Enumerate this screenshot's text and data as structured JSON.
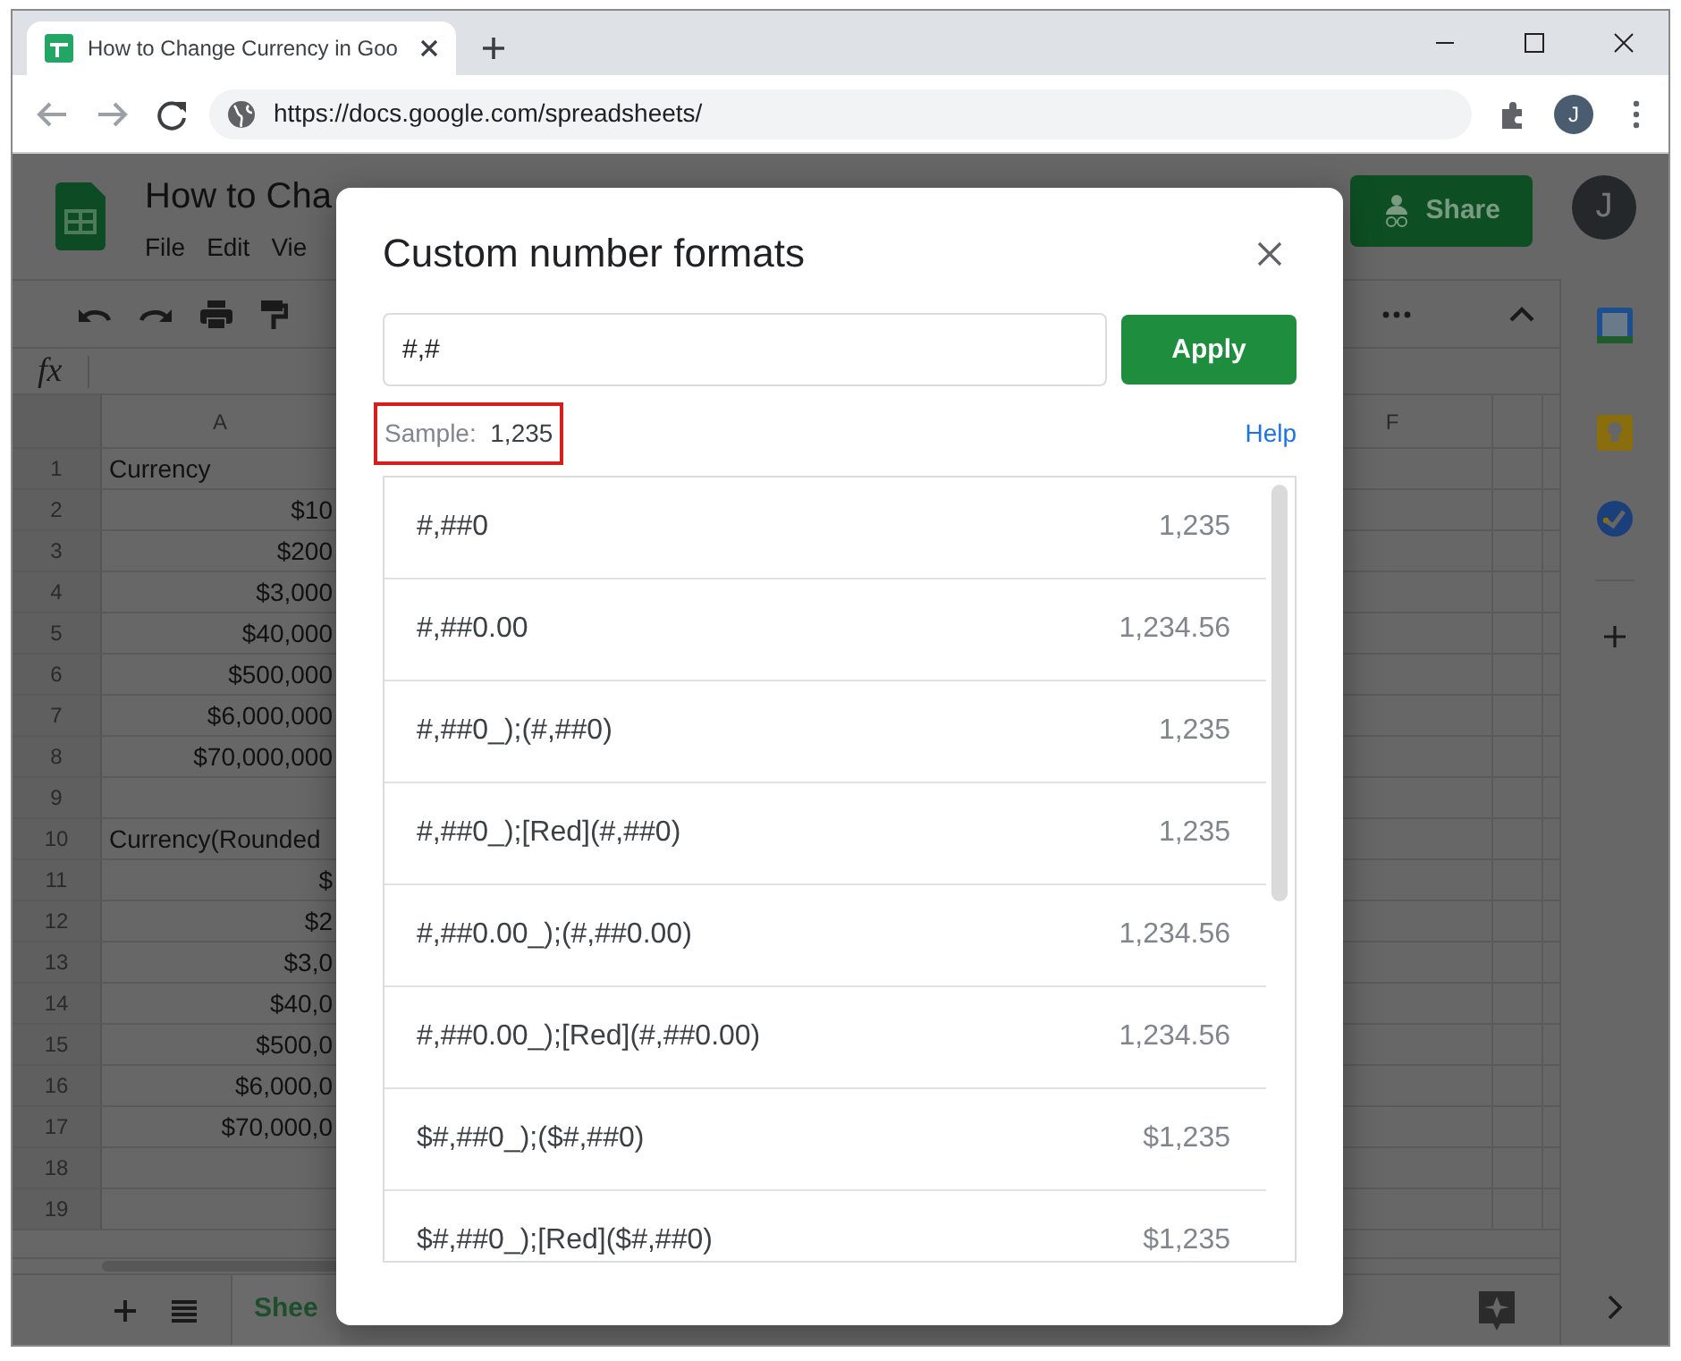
{
  "browser": {
    "tab": {
      "title": "How to Change Currency in Goo",
      "selected": true
    },
    "url": "https://docs.google.com/spreadsheets/",
    "profile_initial": "J"
  },
  "sheets": {
    "doc_title": "How to Cha",
    "menu": [
      "File",
      "Edit",
      "Vie"
    ],
    "share_label": "Share",
    "avatar_initial": "J",
    "formula_label": "fx",
    "columns": [
      "A",
      "F"
    ],
    "rows": [
      {
        "number": "1",
        "column_a": "Currency",
        "kind": "label"
      },
      {
        "number": "2",
        "column_a": "$10",
        "kind": "amount"
      },
      {
        "number": "3",
        "column_a": "$200",
        "kind": "amount"
      },
      {
        "number": "4",
        "column_a": "$3,000",
        "kind": "amount"
      },
      {
        "number": "5",
        "column_a": "$40,000",
        "kind": "amount"
      },
      {
        "number": "6",
        "column_a": "$500,000",
        "kind": "amount"
      },
      {
        "number": "7",
        "column_a": "$6,000,000",
        "kind": "amount"
      },
      {
        "number": "8",
        "column_a": "$70,000,000",
        "kind": "amount"
      },
      {
        "number": "9"
      },
      {
        "number": "10",
        "column_a": "Currency(Rounded",
        "kind": "label"
      },
      {
        "number": "11",
        "column_a": "$",
        "kind": "amount"
      },
      {
        "number": "12",
        "column_a": "$2",
        "kind": "amount"
      },
      {
        "number": "13",
        "column_a": "$3,0",
        "kind": "amount"
      },
      {
        "number": "14",
        "column_a": "$40,0",
        "kind": "amount"
      },
      {
        "number": "15",
        "column_a": "$500,0",
        "kind": "amount"
      },
      {
        "number": "16",
        "column_a": "$6,000,0",
        "kind": "amount"
      },
      {
        "number": "17",
        "column_a": "$70,000,0",
        "kind": "amount"
      },
      {
        "number": "18"
      },
      {
        "number": "19"
      }
    ],
    "sheet_tab": "Shee"
  },
  "dialog": {
    "title": "Custom number formats",
    "format_value": "#,#",
    "apply_label": "Apply",
    "sample_label": "Sample:",
    "sample_value": "1,235",
    "sample_highlighted": true,
    "help_label": "Help",
    "formats": [
      {
        "pattern": "#,##0",
        "sample": "1,235"
      },
      {
        "pattern": "#,##0.00",
        "sample": "1,234.56"
      },
      {
        "pattern": "#,##0_);(#,##0)",
        "sample": "1,235"
      },
      {
        "pattern": "#,##0_);[Red](#,##0)",
        "sample": "1,235"
      },
      {
        "pattern": "#,##0.00_);(#,##0.00)",
        "sample": "1,234.56"
      },
      {
        "pattern": "#,##0.00_);[Red](#,##0.00)",
        "sample": "1,234.56"
      },
      {
        "pattern": "$#,##0_);($#,##0)",
        "sample": "$1,235"
      },
      {
        "pattern": "$#,##0_);[Red]($#,##0)",
        "sample": "$1,235"
      }
    ]
  }
}
